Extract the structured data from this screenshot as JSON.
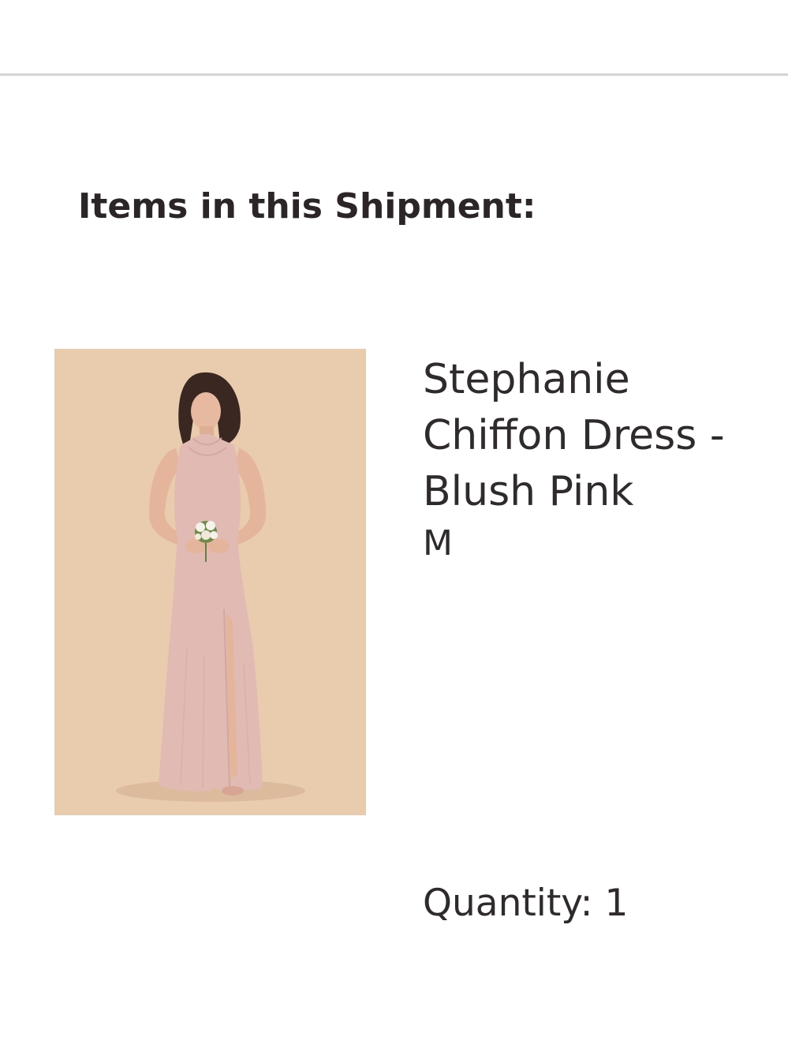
{
  "shipment": {
    "title": "Items in this Shipment:"
  },
  "items": [
    {
      "name": "Stephanie Chiffon Dress - Blush Pink",
      "size": "M",
      "quantity_label": "Quantity:",
      "quantity": "1",
      "image_alt": "model wearing dress"
    }
  ],
  "colors": {
    "text": "#2f2a2b",
    "divider": "#d4d4d4",
    "image_background": "#e9cbae",
    "dress": "#e1bab3"
  }
}
